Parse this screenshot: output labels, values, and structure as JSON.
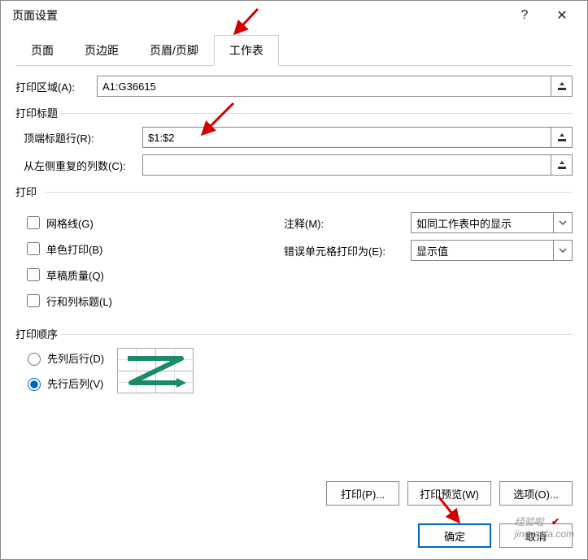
{
  "title": "页面设置",
  "help_glyph": "?",
  "close_glyph": "✕",
  "tabs": {
    "page": "页面",
    "margins": "页边距",
    "header_footer": "页眉/页脚",
    "sheet": "工作表"
  },
  "print_area": {
    "label": "打印区域(A):",
    "value": "A1:G36615"
  },
  "titles": {
    "group": "打印标题",
    "top_rows_label": "顶端标题行(R):",
    "top_rows_value": "$1:$2",
    "left_cols_label": "从左侧重复的列数(C):",
    "left_cols_value": ""
  },
  "print": {
    "group": "打印",
    "gridlines": "网格线(G)",
    "black_white": "单色打印(B)",
    "draft": "草稿质量(Q)",
    "row_col_headings": "行和列标题(L)",
    "comments_label": "注释(M):",
    "comments_value": "如同工作表中的显示",
    "errors_label": "错误单元格打印为(E):",
    "errors_value": "显示值"
  },
  "order": {
    "group": "打印顺序",
    "down_over": "先列后行(D)",
    "over_down": "先行后列(V)"
  },
  "buttons": {
    "print": "打印(P)...",
    "preview": "打印预览(W)",
    "options": "选项(O)...",
    "ok": "确定",
    "cancel": "取消"
  },
  "watermark": "jingyanla.com",
  "watermark_cn": "经验啦"
}
